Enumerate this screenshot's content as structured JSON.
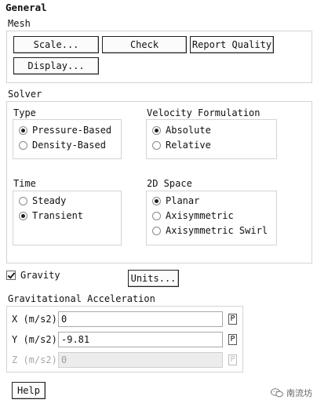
{
  "panel": {
    "title": "General"
  },
  "mesh": {
    "label": "Mesh",
    "buttons": {
      "scale": "Scale...",
      "check": "Check",
      "report_quality": "Report Quality",
      "display": "Display..."
    }
  },
  "solver": {
    "label": "Solver",
    "type": {
      "label": "Type",
      "options": [
        "Pressure-Based",
        "Density-Based"
      ],
      "selected": "Pressure-Based"
    },
    "velocity_formulation": {
      "label": "Velocity Formulation",
      "options": [
        "Absolute",
        "Relative"
      ],
      "selected": "Absolute"
    },
    "time": {
      "label": "Time",
      "options": [
        "Steady",
        "Transient"
      ],
      "selected": "Transient"
    },
    "space_2d": {
      "label": "2D Space",
      "options": [
        "Planar",
        "Axisymmetric",
        "Axisymmetric Swirl"
      ],
      "selected": "Planar"
    }
  },
  "gravity": {
    "label": "Gravity",
    "checked": true
  },
  "units_button": "Units...",
  "grav_accel": {
    "label": "Gravitational Acceleration",
    "x": {
      "label": "X (m/s2)",
      "value": "0",
      "param": "P",
      "enabled": true
    },
    "y": {
      "label": "Y (m/s2)",
      "value": "-9.81",
      "param": "P",
      "enabled": true
    },
    "z": {
      "label": "Z (m/s2)",
      "value": "0",
      "param": "P",
      "enabled": false
    }
  },
  "help_button": "Help",
  "watermark": {
    "text": "南流坊",
    "icon": "wechat-icon"
  }
}
